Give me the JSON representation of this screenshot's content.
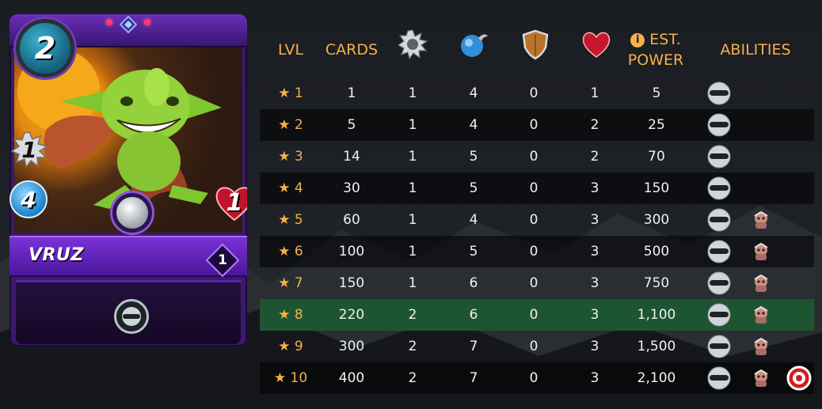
{
  "card": {
    "name": "VRUZ",
    "mana": "2",
    "melee": "1",
    "speed": "4",
    "health": "1",
    "level": "1",
    "ability_icon": "sneak-mask-icon"
  },
  "table": {
    "headers": {
      "lvl": "LVL",
      "cards": "CARDS",
      "attack_icon": "melee-attack-icon",
      "speed_icon": "speed-icon",
      "armor_icon": "armor-shield-icon",
      "health_icon": "health-heart-icon",
      "power_info_icon": "info-icon",
      "power_line1": "EST.",
      "power_line2": "POWER",
      "abilities": "ABILITIES"
    },
    "rows": [
      {
        "lvl": "★ 1",
        "cards": "1",
        "attack": "1",
        "speed": "4",
        "armor": "0",
        "health": "1",
        "power": "5",
        "abilities": [
          "sneak"
        ]
      },
      {
        "lvl": "★ 2",
        "cards": "5",
        "attack": "1",
        "speed": "4",
        "armor": "0",
        "health": "2",
        "power": "25",
        "abilities": [
          "sneak"
        ]
      },
      {
        "lvl": "★ 3",
        "cards": "14",
        "attack": "1",
        "speed": "5",
        "armor": "0",
        "health": "2",
        "power": "70",
        "abilities": [
          "sneak"
        ]
      },
      {
        "lvl": "★ 4",
        "cards": "30",
        "attack": "1",
        "speed": "5",
        "armor": "0",
        "health": "3",
        "power": "150",
        "abilities": [
          "sneak"
        ]
      },
      {
        "lvl": "★ 5",
        "cards": "60",
        "attack": "1",
        "speed": "4",
        "armor": "0",
        "health": "3",
        "power": "300",
        "abilities": [
          "sneak",
          "retaliate"
        ]
      },
      {
        "lvl": "★ 6",
        "cards": "100",
        "attack": "1",
        "speed": "5",
        "armor": "0",
        "health": "3",
        "power": "500",
        "abilities": [
          "sneak",
          "retaliate"
        ]
      },
      {
        "lvl": "★ 7",
        "cards": "150",
        "attack": "1",
        "speed": "6",
        "armor": "0",
        "health": "3",
        "power": "750",
        "abilities": [
          "sneak",
          "retaliate"
        ]
      },
      {
        "lvl": "★ 8",
        "cards": "220",
        "attack": "2",
        "speed": "6",
        "armor": "0",
        "health": "3",
        "power": "1,100",
        "abilities": [
          "sneak",
          "retaliate"
        ]
      },
      {
        "lvl": "★ 9",
        "cards": "300",
        "attack": "2",
        "speed": "7",
        "armor": "0",
        "health": "3",
        "power": "1,500",
        "abilities": [
          "sneak",
          "retaliate"
        ]
      },
      {
        "lvl": "★ 10",
        "cards": "400",
        "attack": "2",
        "speed": "7",
        "armor": "0",
        "health": "3",
        "power": "2,100",
        "abilities": [
          "sneak",
          "retaliate",
          "true-strike"
        ]
      }
    ],
    "highlighted_row": 8
  },
  "colors": {
    "header_text": "#f4b04a",
    "highlight_row": "#1d5532",
    "card_purple": "#6a2fb8"
  }
}
